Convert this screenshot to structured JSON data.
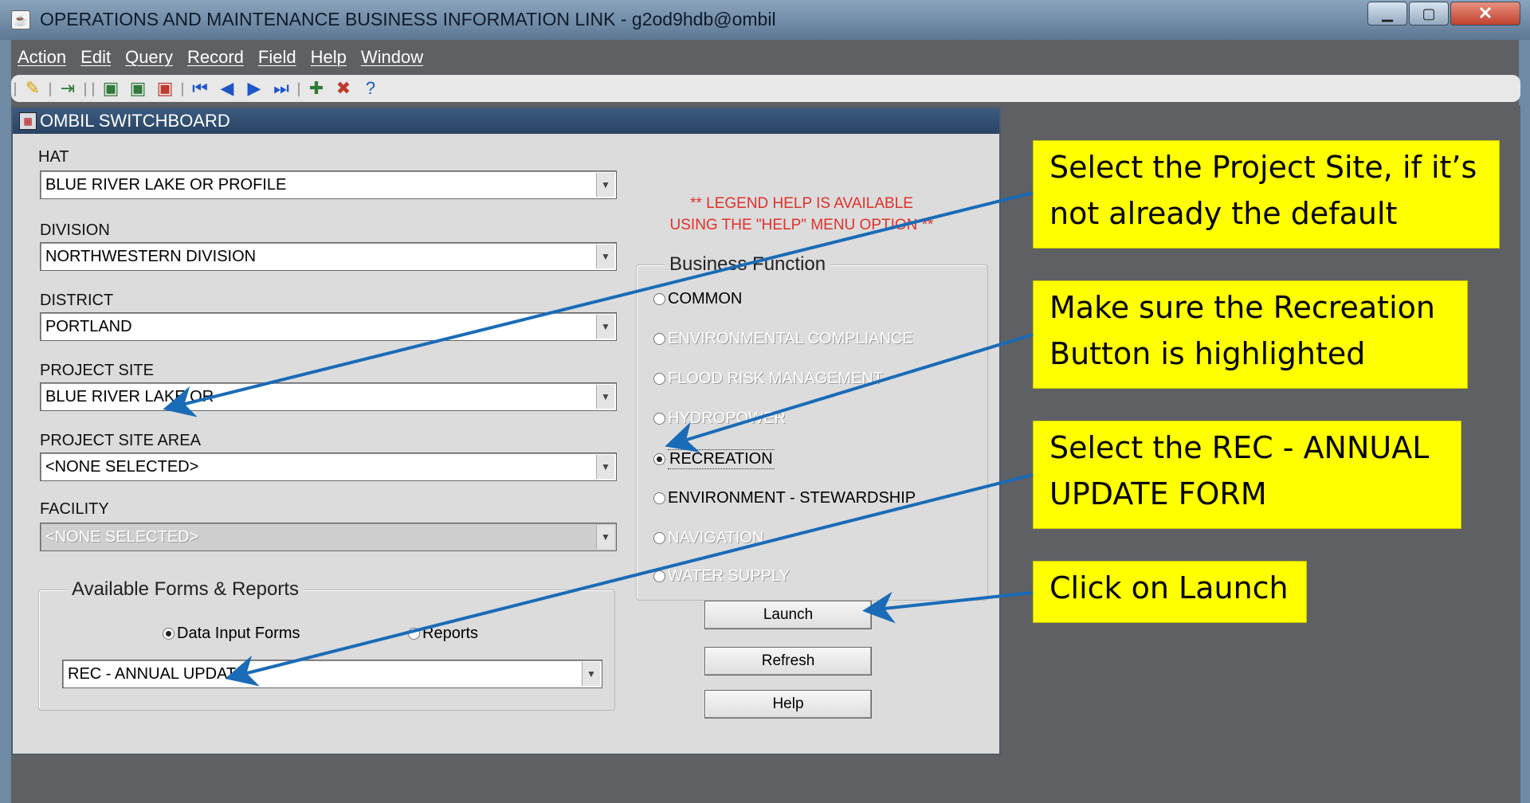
{
  "window": {
    "title": "OPERATIONS AND MAINTENANCE BUSINESS INFORMATION LINK - g2od9hdb@ombil",
    "app_icon": "java-icon"
  },
  "menu": [
    {
      "label": "Action"
    },
    {
      "label": "Edit"
    },
    {
      "label": "Query"
    },
    {
      "label": "Record"
    },
    {
      "label": "Field"
    },
    {
      "label": "Help"
    },
    {
      "label": "Window"
    }
  ],
  "toolbar": {
    "help_glyph": "?"
  },
  "switchboard": {
    "title": "OMBIL SWITCHBOARD",
    "legend_help_line1": "**  LEGEND HELP IS AVAILABLE",
    "legend_help_line2": "USING THE \"HELP\" MENU OPTION **",
    "fields": {
      "hat": {
        "label": "HAT",
        "value": "BLUE RIVER LAKE OR PROFILE"
      },
      "division": {
        "label": "DIVISION",
        "value": "NORTHWESTERN DIVISION"
      },
      "district": {
        "label": "DISTRICT",
        "value": "PORTLAND"
      },
      "project_site": {
        "label": "PROJECT SITE",
        "value": "BLUE RIVER LAKE OR"
      },
      "project_site_area": {
        "label": "PROJECT SITE AREA",
        "value": "<NONE SELECTED>"
      },
      "facility": {
        "label": "FACILITY",
        "value": "<NONE SELECTED>"
      }
    },
    "business_function": {
      "title": "Business Function",
      "options": [
        {
          "label": "COMMON",
          "enabled": true,
          "selected": false
        },
        {
          "label": "ENVIRONMENTAL COMPLIANCE",
          "enabled": false,
          "selected": false
        },
        {
          "label": "FLOOD RISK MANAGEMENT",
          "enabled": false,
          "selected": false
        },
        {
          "label": "HYDROPOWER",
          "enabled": false,
          "selected": false
        },
        {
          "label": "RECREATION",
          "enabled": true,
          "selected": true
        },
        {
          "label": "ENVIRONMENT - STEWARDSHIP",
          "enabled": true,
          "selected": false
        },
        {
          "label": "NAVIGATION",
          "enabled": false,
          "selected": false
        },
        {
          "label": "WATER SUPPLY",
          "enabled": false,
          "selected": false
        }
      ]
    },
    "forms_reports": {
      "title": "Available Forms & Reports",
      "data_input_forms": "Data Input Forms",
      "reports": "Reports",
      "selected_mode": "Data Input Forms",
      "form_value": "REC - ANNUAL UPDATE"
    },
    "buttons": {
      "launch": "Launch",
      "refresh": "Refresh",
      "help": "Help"
    }
  },
  "callouts": {
    "project_site_line1": "Select the Project Site, if it’s",
    "project_site_line2": "not already the default",
    "recreation_line1": "Make sure the Recreation",
    "recreation_line2": "Button is highlighted",
    "form_line1": "Select the REC - ANNUAL",
    "form_line2": "UPDATE FORM",
    "launch": "Click on Launch"
  },
  "colors": {
    "callout_bg": "#ffff00",
    "arrow": "#1a6bb8",
    "legend_help": "#e0312b"
  }
}
